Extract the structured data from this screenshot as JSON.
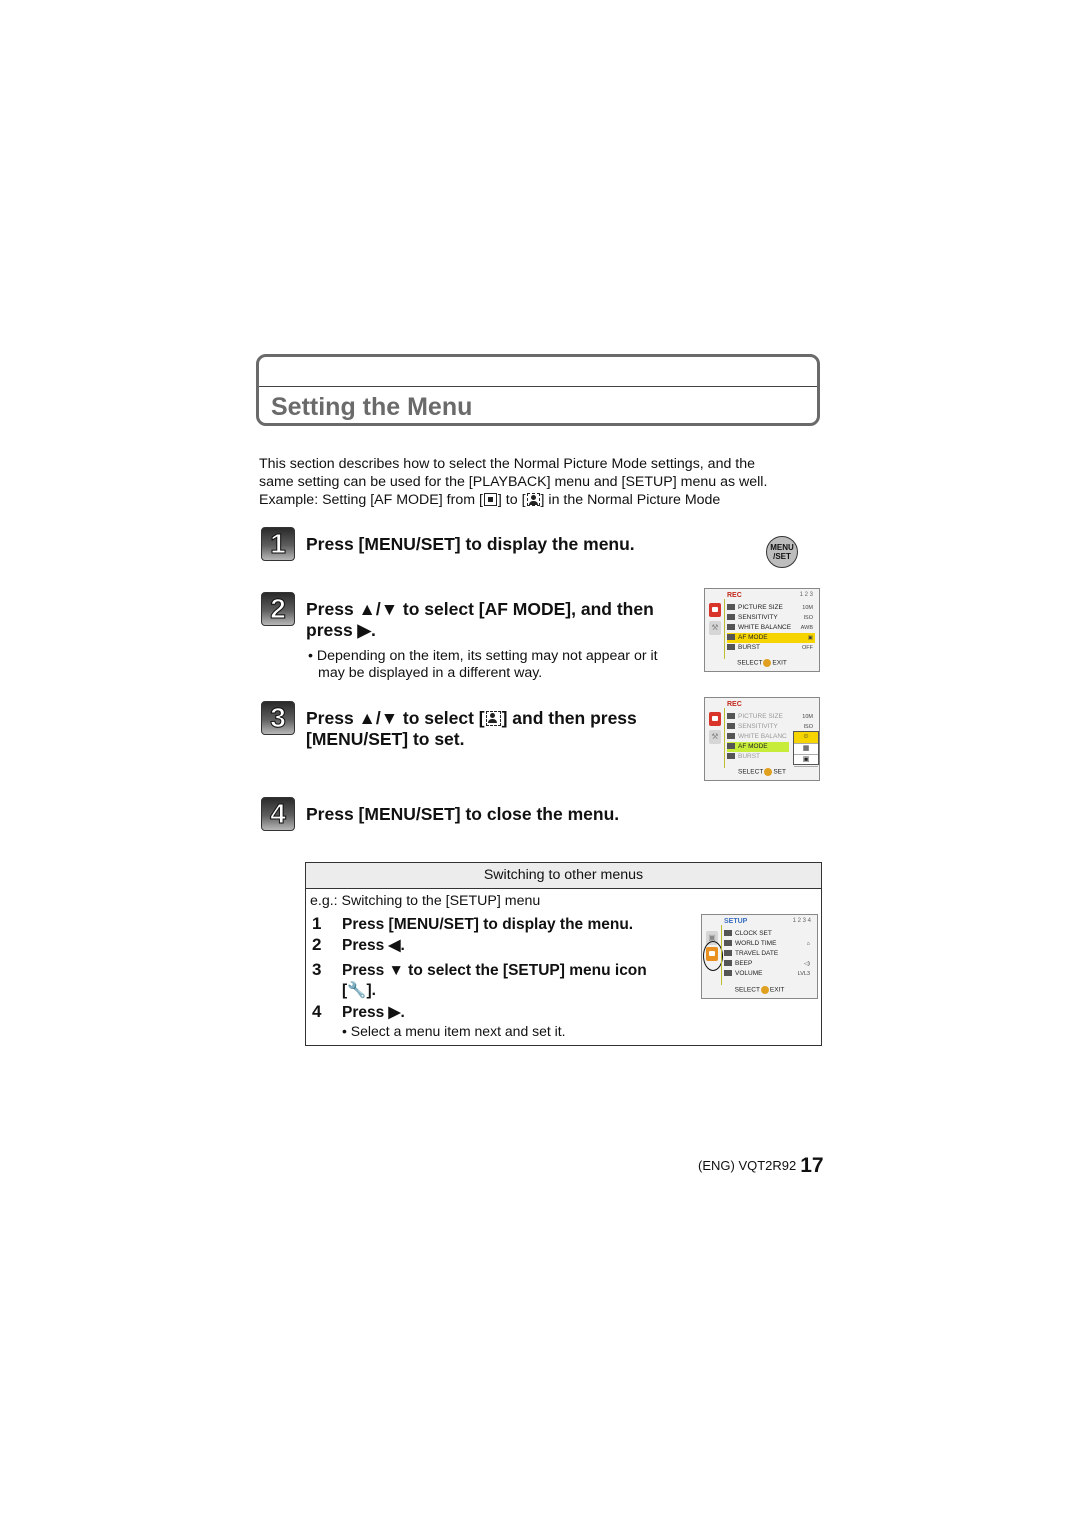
{
  "section": {
    "title": "Setting the Menu"
  },
  "intro": {
    "line1": "This section describes how to select the Normal Picture Mode settings, and the",
    "line2": "same setting can be used for the [PLAYBACK] menu and [SETUP] menu as well.",
    "line3_a": "Example: Setting [AF MODE] from [",
    "line3_b": "] to [",
    "line3_c": "] in the Normal Picture Mode",
    "from_icon": "af-spot-icon",
    "to_icon": "face-detection-icon"
  },
  "steps": [
    {
      "number": "1",
      "text": "Press [MENU/SET] to display the menu."
    },
    {
      "number": "2",
      "text_line1": "Press ▲/▼ to select [AF MODE], and then",
      "text_line2": "press ▶.",
      "note_line1": "• Depending on the item, its setting may not appear or it",
      "note_line2": "may be displayed in a different way."
    },
    {
      "number": "3",
      "text_line1a": "Press ▲/▼ to select [",
      "text_line1b": "] and then press",
      "text_line2": "[MENU/SET] to set."
    },
    {
      "number": "4",
      "text": "Press [MENU/SET] to close the menu."
    }
  ],
  "menu_button": {
    "line1": "MENU",
    "line2": "/SET"
  },
  "screen_rec_1": {
    "header": "REC",
    "page": "1 2 3",
    "rows": [
      {
        "label": "PICTURE SIZE",
        "value": "10M"
      },
      {
        "label": "SENSITIVITY",
        "value": "ISO"
      },
      {
        "label": "WHITE BALANCE",
        "value": "AWB"
      },
      {
        "label": "AF MODE",
        "value": "▣"
      },
      {
        "label": "BURST",
        "value": "OFF"
      }
    ],
    "footer_a": "SELECT",
    "footer_b": "EXIT"
  },
  "screen_rec_2": {
    "header": "REC",
    "rows": [
      {
        "label": "PICTURE SIZE",
        "value": "10M"
      },
      {
        "label": "SENSITIVITY",
        "value": "ISO"
      },
      {
        "label": "WHITE BALANC",
        "value": ""
      },
      {
        "label": "AF MODE",
        "value": ""
      },
      {
        "label": "BURST",
        "value": ""
      }
    ],
    "popup": [
      "☺",
      "▦",
      "▣"
    ],
    "footer_a": "SELECT",
    "footer_b": "SET"
  },
  "switching": {
    "heading": "Switching to other menus",
    "example": "e.g.: Switching to the [SETUP] menu",
    "steps": [
      {
        "n": "1",
        "text": "Press [MENU/SET] to display the menu."
      },
      {
        "n": "2",
        "text": "Press ◀."
      },
      {
        "n": "3",
        "text": "Press ▼ to select the [SETUP] menu icon"
      },
      {
        "n": "",
        "text": "[🔧]."
      },
      {
        "n": "4",
        "text": "Press ▶."
      }
    ],
    "note": "• Select a menu item next and set it."
  },
  "screen_setup": {
    "header": "SETUP",
    "page": "1 2 3 4",
    "rows": [
      {
        "label": "CLOCK SET",
        "value": ""
      },
      {
        "label": "WORLD TIME",
        "value": "⌂"
      },
      {
        "label": "TRAVEL DATE",
        "value": ""
      },
      {
        "label": "BEEP",
        "value": "◁)"
      },
      {
        "label": "VOLUME",
        "value": "LVL3"
      }
    ],
    "footer_a": "SELECT",
    "footer_b": "EXIT"
  },
  "footer": {
    "code": "(ENG) VQT2R92",
    "page_number": "17"
  }
}
